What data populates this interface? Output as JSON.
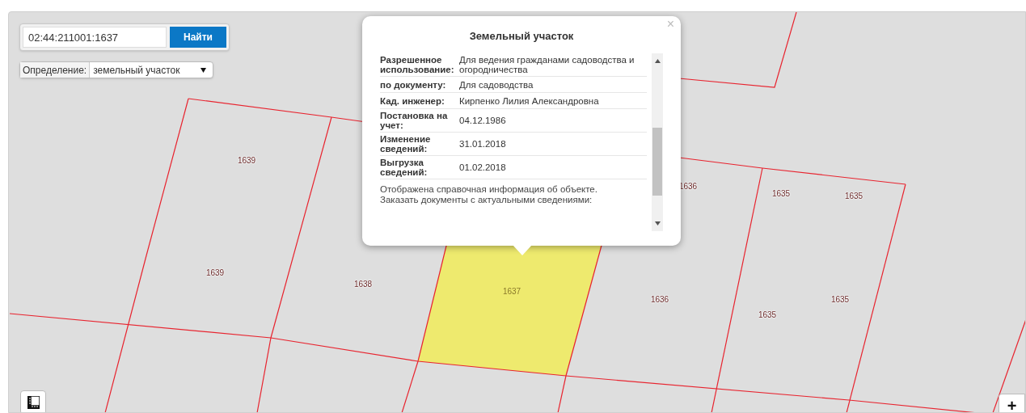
{
  "search": {
    "value": "02:44:211001:1637",
    "button": "Найти"
  },
  "identify": {
    "label": "Определение:",
    "value": "земельный участок"
  },
  "popup": {
    "title": "Земельный участок",
    "close": "×",
    "rows": [
      {
        "label": "Разрешенное использование:",
        "value": "Для ведения гражданами садоводства и огородничества"
      },
      {
        "label": "по документу:",
        "value": "Для садоводства"
      },
      {
        "label": "Кад. инженер:",
        "value": "Кирпенко Лилия Александровна"
      },
      {
        "label": "Постановка на учет:",
        "value": "04.12.1986"
      },
      {
        "label": "Изменение сведений:",
        "value": "31.01.2018"
      },
      {
        "label": "Выгрузка сведений:",
        "value": "01.02.2018"
      }
    ],
    "note": "Отображена справочная информация об объекте. Заказать документы с актуальными сведениями:"
  },
  "map": {
    "labels": [
      {
        "text": "1639",
        "selected": false
      },
      {
        "text": "1639",
        "selected": false
      },
      {
        "text": "1638",
        "selected": false
      },
      {
        "text": "1637",
        "selected": true
      },
      {
        "text": "1636",
        "selected": false
      },
      {
        "text": "1636",
        "selected": false
      },
      {
        "text": "1635",
        "selected": false
      },
      {
        "text": "1635",
        "selected": false
      },
      {
        "text": "1635",
        "selected": false
      },
      {
        "text": "1635",
        "selected": false
      }
    ],
    "zoom_in": "+"
  }
}
